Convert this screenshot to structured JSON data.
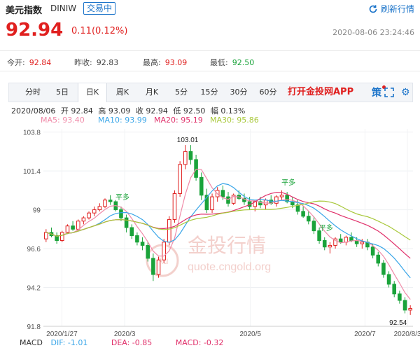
{
  "header": {
    "title": "美元指数",
    "symbol": "DINIW",
    "status": "交易中",
    "refresh": "刷新行情",
    "price": "92.94",
    "change": "0.11(0.12%)",
    "timestamp": "2020-08-06 23:24:46"
  },
  "stats": [
    {
      "label": "今开:",
      "value": "92.84"
    },
    {
      "label": "昨收:",
      "value": "92.83"
    },
    {
      "label": "最高:",
      "value": "93.09"
    },
    {
      "label": "最低:",
      "value": "92.50"
    }
  ],
  "tabs": [
    "分时",
    "5日",
    "日K",
    "周K",
    "月K",
    "5分",
    "15分",
    "30分",
    "60分"
  ],
  "active_tab": "日K",
  "app_link": "打开金投网APP",
  "ce_icon": "策",
  "ohlc": {
    "date": "2020/08/06",
    "open": "开 92.84",
    "high": "高 93.09",
    "close": "收 92.94",
    "low": "低 92.50",
    "amp": "幅 0.13%"
  },
  "ma": [
    {
      "label": "MA5: 93.40",
      "color": "#f08aa8"
    },
    {
      "label": "MA10: 93.99",
      "color": "#3aa6e8"
    },
    {
      "label": "MA20: 95.19",
      "color": "#e0306a"
    },
    {
      "label": "MA30: 95.86",
      "color": "#a8c83a"
    }
  ],
  "macd": [
    {
      "label": "MACD",
      "color": "#333333"
    },
    {
      "label": "DIF: -1.01",
      "color": "#3aa6e8"
    },
    {
      "label": "DEA: -0.85",
      "color": "#e0306a"
    },
    {
      "label": "MACD: -0.32",
      "color": "#e0306a"
    }
  ],
  "watermark": {
    "brand": "金投行情",
    "url": "quote.cngold.org",
    "logo": "Au"
  },
  "colors": {
    "up": "#e0201f",
    "down": "#1aa33a",
    "accent": "#1a73c9"
  },
  "chart_data": {
    "type": "candlestick",
    "y_ticks": [
      103.8,
      101.4,
      99,
      96.6,
      94.2,
      91.8
    ],
    "ylim": [
      91.8,
      104.0
    ],
    "x_ticks": [
      "2020/1/27",
      "2020/3",
      "2020/5",
      "2020/7",
      "2020/8/3"
    ],
    "annotations": {
      "max": "103.01",
      "min": "92.54",
      "marker": "平多"
    },
    "candles": [
      [
        97.2,
        97.8,
        97.0,
        97.6
      ],
      [
        97.6,
        97.9,
        97.3,
        97.4
      ],
      [
        97.4,
        97.6,
        96.9,
        97.1
      ],
      [
        97.1,
        97.7,
        97.0,
        97.6
      ],
      [
        97.6,
        98.1,
        97.5,
        98.0
      ],
      [
        98.0,
        98.3,
        97.7,
        97.8
      ],
      [
        97.8,
        98.4,
        97.7,
        98.3
      ],
      [
        98.3,
        98.6,
        98.1,
        98.5
      ],
      [
        98.5,
        98.9,
        98.4,
        98.8
      ],
      [
        98.8,
        99.2,
        98.6,
        99.0
      ],
      [
        99.0,
        99.4,
        98.9,
        99.2
      ],
      [
        99.2,
        99.7,
        99.1,
        99.6
      ],
      [
        99.6,
        99.9,
        99.3,
        99.5
      ],
      [
        99.5,
        99.6,
        98.9,
        99.0
      ],
      [
        99.0,
        99.2,
        98.3,
        98.5
      ],
      [
        98.5,
        98.7,
        97.6,
        97.9
      ],
      [
        97.9,
        98.1,
        97.2,
        97.4
      ],
      [
        97.4,
        97.6,
        96.8,
        97.0
      ],
      [
        97.0,
        97.3,
        96.5,
        96.8
      ],
      [
        96.8,
        97.0,
        95.8,
        96.0
      ],
      [
        96.0,
        96.3,
        94.6,
        95.0
      ],
      [
        95.0,
        96.1,
        94.8,
        95.9
      ],
      [
        95.9,
        97.2,
        95.7,
        97.0
      ],
      [
        97.0,
        98.6,
        96.8,
        98.4
      ],
      [
        98.4,
        100.2,
        98.2,
        100.0
      ],
      [
        100.0,
        102.0,
        99.8,
        101.8
      ],
      [
        101.8,
        103.0,
        101.5,
        102.6
      ],
      [
        102.6,
        103.0,
        101.8,
        102.1
      ],
      [
        102.1,
        102.4,
        100.8,
        101.0
      ],
      [
        101.0,
        101.3,
        99.6,
        99.9
      ],
      [
        99.9,
        100.3,
        98.8,
        99.0
      ],
      [
        99.0,
        100.0,
        98.8,
        99.8
      ],
      [
        99.8,
        100.4,
        99.5,
        100.2
      ],
      [
        100.2,
        100.5,
        99.6,
        99.8
      ],
      [
        99.8,
        100.1,
        99.2,
        99.4
      ],
      [
        99.4,
        100.0,
        99.3,
        99.9
      ],
      [
        99.9,
        100.2,
        99.6,
        99.7
      ],
      [
        99.7,
        100.0,
        99.3,
        99.5
      ],
      [
        99.5,
        99.8,
        99.0,
        99.2
      ],
      [
        99.2,
        99.6,
        98.9,
        99.5
      ],
      [
        99.5,
        99.8,
        99.1,
        99.3
      ],
      [
        99.3,
        99.7,
        99.0,
        99.6
      ],
      [
        99.6,
        99.9,
        99.3,
        99.4
      ],
      [
        99.4,
        99.9,
        99.2,
        99.8
      ],
      [
        99.8,
        100.2,
        99.6,
        99.9
      ],
      [
        99.9,
        100.1,
        99.4,
        99.5
      ],
      [
        99.5,
        99.8,
        99.1,
        99.3
      ],
      [
        99.3,
        99.6,
        98.7,
        98.9
      ],
      [
        98.9,
        99.2,
        98.5,
        98.6
      ],
      [
        98.6,
        98.9,
        98.1,
        98.3
      ],
      [
        98.3,
        98.6,
        97.5,
        97.7
      ],
      [
        97.7,
        97.9,
        96.9,
        97.1
      ],
      [
        97.1,
        97.3,
        96.5,
        96.7
      ],
      [
        96.7,
        97.0,
        96.3,
        96.8
      ],
      [
        96.8,
        97.3,
        96.6,
        97.2
      ],
      [
        97.2,
        97.5,
        96.9,
        97.0
      ],
      [
        97.0,
        97.4,
        96.8,
        97.3
      ],
      [
        97.3,
        97.6,
        97.0,
        97.1
      ],
      [
        97.1,
        97.3,
        96.7,
        96.9
      ],
      [
        96.9,
        97.2,
        96.6,
        97.0
      ],
      [
        97.0,
        97.2,
        96.5,
        96.7
      ],
      [
        96.7,
        96.9,
        96.0,
        96.2
      ],
      [
        96.2,
        96.4,
        95.5,
        95.7
      ],
      [
        95.7,
        95.9,
        94.8,
        95.0
      ],
      [
        95.0,
        95.2,
        94.2,
        94.4
      ],
      [
        94.4,
        94.6,
        93.6,
        93.8
      ],
      [
        93.8,
        94.0,
        93.2,
        93.4
      ],
      [
        93.4,
        93.6,
        92.6,
        92.8
      ],
      [
        92.8,
        93.1,
        92.5,
        92.9
      ]
    ]
  }
}
